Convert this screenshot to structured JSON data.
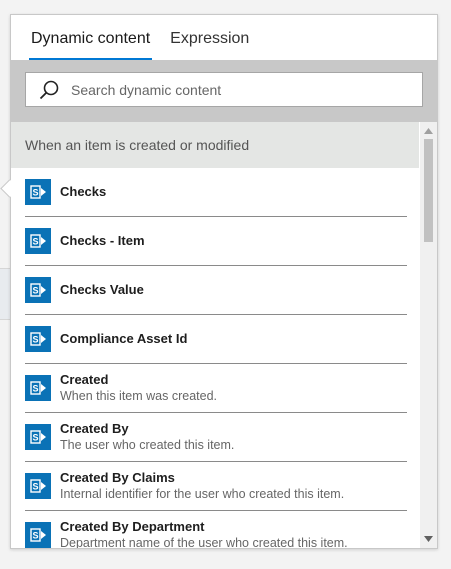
{
  "tabs": [
    {
      "label": "Dynamic content",
      "active": true
    },
    {
      "label": "Expression",
      "active": false
    }
  ],
  "search": {
    "placeholder": "Search dynamic content"
  },
  "group": {
    "title": "When an item is created or modified"
  },
  "items": [
    {
      "name": "Checks",
      "desc": ""
    },
    {
      "name": "Checks - Item",
      "desc": ""
    },
    {
      "name": "Checks Value",
      "desc": ""
    },
    {
      "name": "Compliance Asset Id",
      "desc": ""
    },
    {
      "name": "Created",
      "desc": "When this item was created."
    },
    {
      "name": "Created By",
      "desc": "The user who created this item."
    },
    {
      "name": "Created By Claims",
      "desc": "Internal identifier for the user who created this item."
    },
    {
      "name": "Created By Department",
      "desc": "Department name of the user who created this item."
    }
  ],
  "icons": {
    "item_icon": "sharepoint-icon",
    "search": "search-icon"
  },
  "colors": {
    "accent": "#0078d4",
    "icon_bg": "#0a72b6",
    "search_band": "#c8c8c8",
    "group_header": "#e4e6e4"
  }
}
